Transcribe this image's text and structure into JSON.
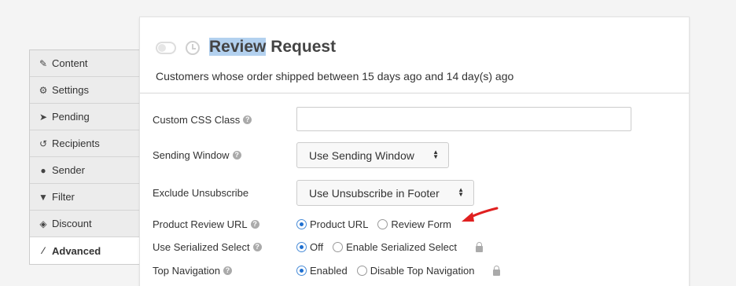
{
  "sidebar": {
    "items": [
      {
        "label": "Content",
        "icon": "edit-icon"
      },
      {
        "label": "Settings",
        "icon": "gear-icon"
      },
      {
        "label": "Pending",
        "icon": "paper-plane-icon"
      },
      {
        "label": "Recipients",
        "icon": "history-icon"
      },
      {
        "label": "Sender",
        "icon": "user-icon"
      },
      {
        "label": "Filter",
        "icon": "filter-icon"
      },
      {
        "label": "Discount",
        "icon": "tag-icon"
      },
      {
        "label": "Advanced",
        "icon": "magic-wand-icon"
      }
    ],
    "active": "Advanced"
  },
  "header": {
    "title_highlight": "Review",
    "title_rest": " Request",
    "subtitle": "Customers whose order shipped between 15 days ago and 14 day(s) ago"
  },
  "form": {
    "css_class": {
      "label": "Custom CSS Class",
      "value": ""
    },
    "sending_window": {
      "label": "Sending Window",
      "value": "Use Sending Window"
    },
    "exclude_unsubscribe": {
      "label": "Exclude Unsubscribe",
      "value": "Use Unsubscribe in Footer"
    },
    "product_review_url": {
      "label": "Product Review URL",
      "options": [
        "Product URL",
        "Review Form"
      ],
      "selected": "Product URL"
    },
    "serialized_select": {
      "label": "Use Serialized Select",
      "options": [
        "Off",
        "Enable Serialized Select"
      ],
      "selected": "Off"
    },
    "top_navigation": {
      "label": "Top Navigation",
      "options": [
        "Enabled",
        "Disable Top Navigation"
      ],
      "selected": "Enabled"
    }
  },
  "help_glyph": "?",
  "colors": {
    "highlight": "#b3d1ef",
    "radio_selected": "#1e6fd0",
    "arrow": "#e02020"
  }
}
